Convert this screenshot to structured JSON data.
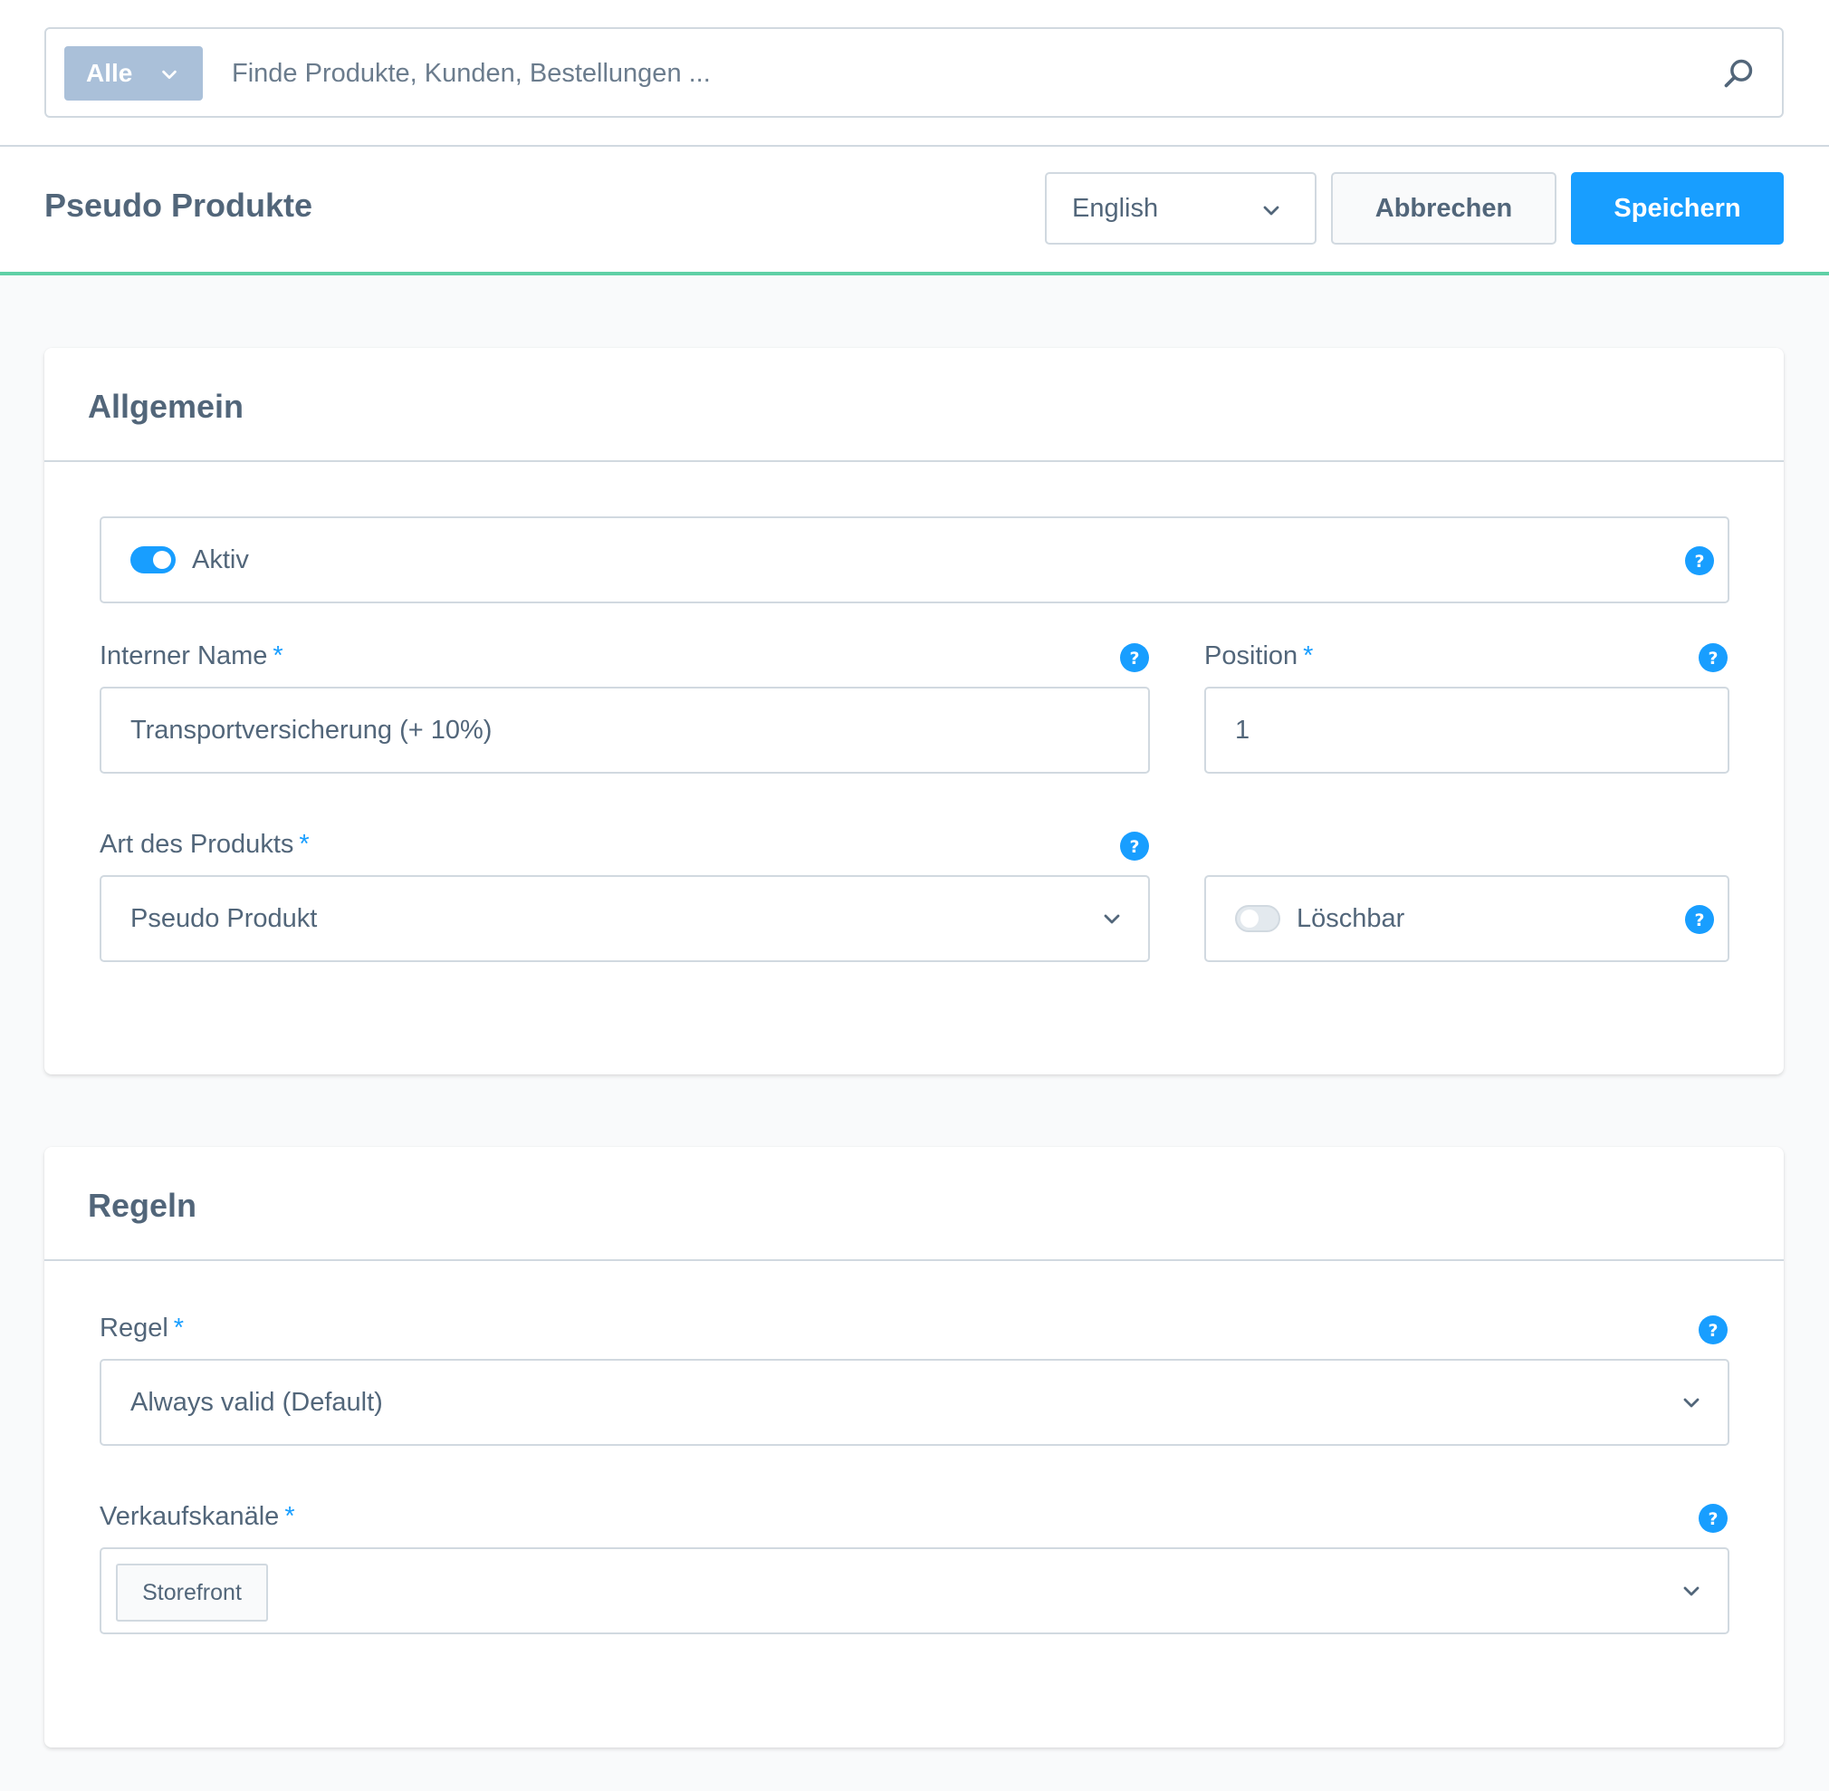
{
  "search": {
    "scope_label": "Alle",
    "placeholder": "Finde Produkte, Kunden, Bestellungen ...",
    "value": ""
  },
  "header": {
    "title": "Pseudo Produkte",
    "language": "English",
    "cancel_label": "Abbrechen",
    "save_label": "Speichern"
  },
  "general": {
    "title": "Allgemein",
    "active": {
      "label": "Aktiv",
      "checked": true
    },
    "internal_name": {
      "label": "Interner Name",
      "required": "*",
      "value": "Transportversicherung (+ 10%)"
    },
    "position": {
      "label": "Position",
      "required": "*",
      "value": "1"
    },
    "product_type": {
      "label": "Art des Produkts",
      "required": "*",
      "value": "Pseudo Produkt"
    },
    "deletable": {
      "label": "Löschbar",
      "checked": false
    }
  },
  "rules": {
    "title": "Regeln",
    "rule": {
      "label": "Regel",
      "required": "*",
      "value": "Always valid (Default)"
    },
    "sales_channels": {
      "label": "Verkaufskanäle",
      "required": "*",
      "tags": [
        "Storefront"
      ]
    }
  },
  "colors": {
    "accent": "#189eff",
    "header_underline": "#5fd0a6",
    "scope_button": "#aac0d9",
    "text": "#52667a",
    "border": "#d1d9e0"
  },
  "icons": {
    "search": "magnifier-icon",
    "help": "question-circle-icon",
    "dropdown": "chevron-down-icon"
  }
}
